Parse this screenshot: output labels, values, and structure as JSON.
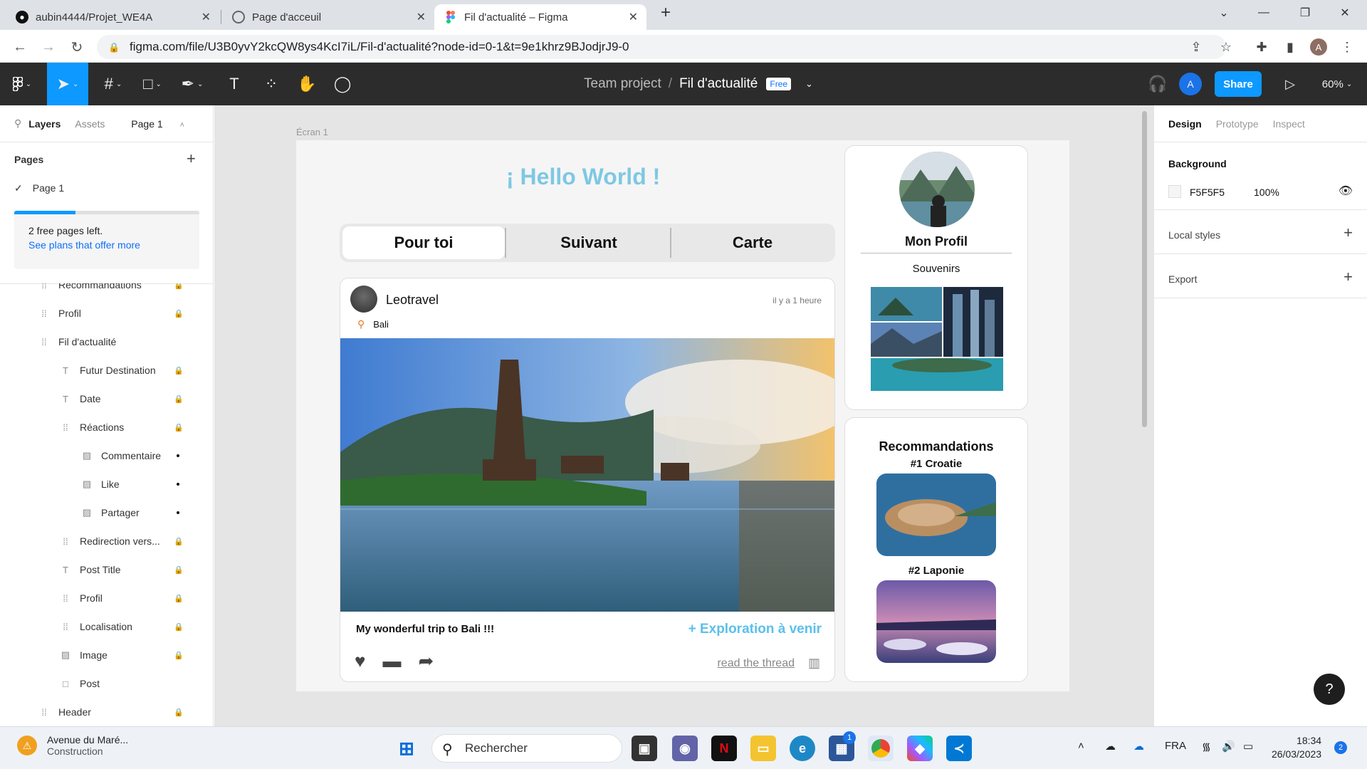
{
  "browser": {
    "tabs": [
      {
        "title": "aubin4444/Projet_WE4A",
        "icon": "github-icon"
      },
      {
        "title": "Page d'acceuil",
        "icon": "globe-icon"
      },
      {
        "title": "Fil d'actualité – Figma",
        "icon": "figma-icon"
      }
    ],
    "url": "figma.com/file/U3B0yvY2kcQW8ys4KcI7iL/Fil-d'actualité?node-id=0-1&t=9e1khrz9BJodjrJ9-0",
    "profile_initial": "A"
  },
  "figma": {
    "project": "Team project",
    "file": "Fil d'actualité",
    "plan_badge": "Free",
    "share_label": "Share",
    "zoom": "60%",
    "user_initial": "A"
  },
  "left_panel": {
    "tabs": [
      "Layers",
      "Assets"
    ],
    "page_selector": "Page 1",
    "pages_heading": "Pages",
    "current_page": "Page 1",
    "free_pages_text": "2 free pages left.",
    "free_pages_link": "See plans that offer more",
    "free_pages_fill": 0.33,
    "layers": [
      {
        "name": "Recommandations",
        "type": "frame",
        "indent": 0,
        "state": "lock"
      },
      {
        "name": "Profil",
        "type": "frame",
        "indent": 0,
        "state": "lock"
      },
      {
        "name": "Fil d'actualité",
        "type": "frame",
        "indent": 0,
        "state": ""
      },
      {
        "name": "Futur Destination",
        "type": "text",
        "indent": 1,
        "state": "lock"
      },
      {
        "name": "Date",
        "type": "text",
        "indent": 1,
        "state": "lock"
      },
      {
        "name": "Réactions",
        "type": "frame",
        "indent": 1,
        "state": "lock"
      },
      {
        "name": "Commentaire",
        "type": "image",
        "indent": 2,
        "state": "dot"
      },
      {
        "name": "Like",
        "type": "image",
        "indent": 2,
        "state": "dot"
      },
      {
        "name": "Partager",
        "type": "image",
        "indent": 2,
        "state": "dot"
      },
      {
        "name": "Redirection vers...",
        "type": "frame",
        "indent": 1,
        "state": "lock"
      },
      {
        "name": "Post Title",
        "type": "text",
        "indent": 1,
        "state": "lock"
      },
      {
        "name": "Profil",
        "type": "frame",
        "indent": 1,
        "state": "lock"
      },
      {
        "name": "Localisation",
        "type": "frame",
        "indent": 1,
        "state": "lock"
      },
      {
        "name": "Image",
        "type": "image",
        "indent": 1,
        "state": "lock"
      },
      {
        "name": "Post",
        "type": "rect",
        "indent": 1,
        "state": ""
      },
      {
        "name": "Header",
        "type": "frame",
        "indent": 0,
        "state": "lock"
      }
    ]
  },
  "canvas": {
    "frame_label": "Écran 1",
    "hello": "¡ Hello World !",
    "feed_tabs": [
      "Pour toi",
      "Suivant",
      "Carte"
    ],
    "post": {
      "user": "Leotravel",
      "time": "il y a 1 heure",
      "location": "Bali",
      "title": "My wonderful trip to Bali !!!",
      "explore": "+ Exploration à venir",
      "read_link": "read the thread"
    },
    "profile": {
      "name": "Mon Profil",
      "souvenirs": "Souvenirs"
    },
    "recommendations": {
      "title": "Recommandations",
      "items": [
        "#1 Croatie",
        "#2 Laponie"
      ]
    }
  },
  "right_panel": {
    "tabs": [
      "Design",
      "Prototype",
      "Inspect"
    ],
    "background_label": "Background",
    "bg_hex": "F5F5F5",
    "bg_opacity": "100%",
    "local_styles": "Local styles",
    "export": "Export"
  },
  "taskbar": {
    "weather_title": "Avenue du Maré...",
    "weather_sub": "Construction",
    "search_placeholder": "Rechercher",
    "lang": "FRA",
    "time": "18:34",
    "date": "26/03/2023",
    "notif_count": "2",
    "store_badge": "1"
  }
}
